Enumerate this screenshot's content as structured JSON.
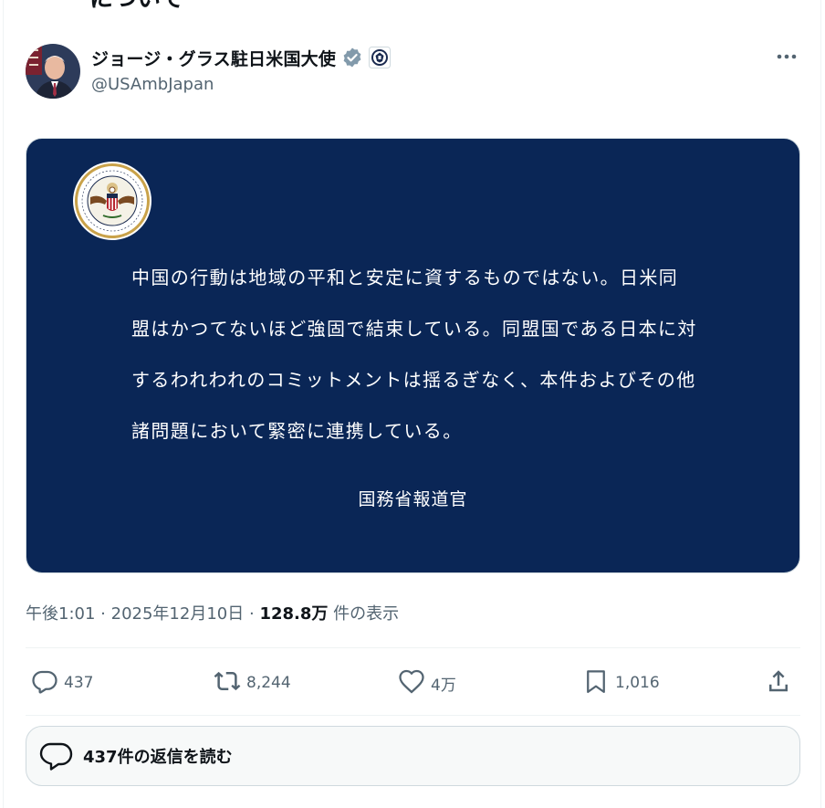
{
  "header": {
    "cut_text": "について"
  },
  "author": {
    "name": "ジョージ・グラス駐日米国大使",
    "handle": "@USAmbJapan",
    "verified_icon": "verified-badge-icon",
    "affiliation_icon": "state-department-seal-icon"
  },
  "media": {
    "statement": "中国の行動は地域の平和と安定に資するものではない。日米同盟はかつてないほど強固で結束している。同盟国である日本に対するわれわれのコミットメントは揺るぎなく、本件およびその他諸問題において緊密に連携している。",
    "signer": "国務省報道官",
    "background_color": "#0a2656"
  },
  "meta": {
    "time": "午後1:01",
    "separator": "·",
    "date": "2025年12月10日",
    "views_count": "128.8万",
    "views_label": "件の表示"
  },
  "actions": {
    "reply_count": "437",
    "repost_count": "8,244",
    "like_count": "4万",
    "bookmark_count": "1,016"
  },
  "replies_button": {
    "label": "437件の返信を読む"
  }
}
